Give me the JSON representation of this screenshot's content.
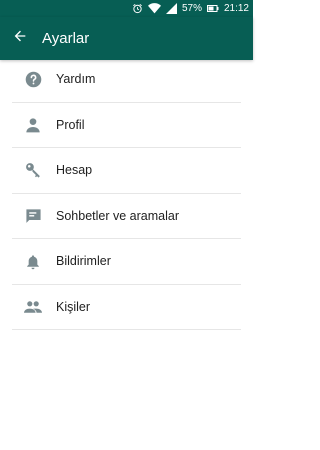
{
  "status_bar": {
    "battery": "57%",
    "time": "21:12",
    "icons": [
      "alarm-icon",
      "wifi-icon",
      "signal-icon",
      "battery-icon"
    ]
  },
  "app_bar": {
    "title": "Ayarlar",
    "back_icon": "arrow-left-icon",
    "color": "#075e54"
  },
  "menu": {
    "items": [
      {
        "label": "Yardım",
        "icon": "help-icon"
      },
      {
        "label": "Profil",
        "icon": "person-icon"
      },
      {
        "label": "Hesap",
        "icon": "key-icon"
      },
      {
        "label": "Sohbetler ve aramalar",
        "icon": "chat-icon"
      },
      {
        "label": "Bildirimler",
        "icon": "bell-icon"
      },
      {
        "label": "Kişiler",
        "icon": "people-icon"
      }
    ],
    "icon_color": "#7a8a8f"
  }
}
